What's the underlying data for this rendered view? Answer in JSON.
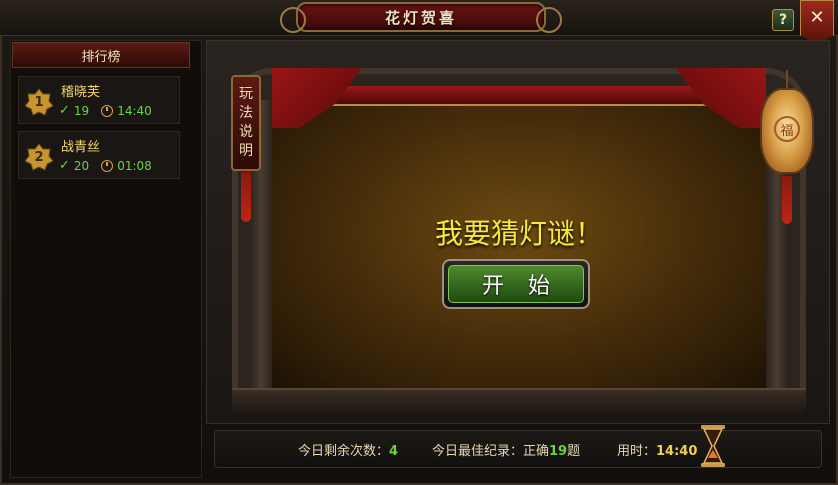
{
  "window": {
    "title": "花灯贺喜",
    "help_label": "?",
    "close_label": "✕"
  },
  "leaderboard": {
    "header": "排行榜",
    "entries": [
      {
        "rank": "1",
        "name": "稽晓芙",
        "correct": "19",
        "time": "14:40"
      },
      {
        "rank": "2",
        "name": "战青丝",
        "correct": "20",
        "time": "01:08"
      }
    ]
  },
  "stage": {
    "rules_chars": [
      "玩",
      "法",
      "说",
      "明"
    ],
    "lantern_mark": "福",
    "prompt": "我要猜灯谜！",
    "start_label": "开始"
  },
  "status": {
    "remaining_label": "今日剩余次数：",
    "remaining_value": "4",
    "best_label": "今日最佳纪录：正确",
    "best_value": "19",
    "best_suffix": "题",
    "time_label": "用时：",
    "time_value": "14:40"
  },
  "colors": {
    "accent_green": "#67d43c",
    "prompt_yellow": "#f3ea3c",
    "name_gold": "#f4d66a"
  }
}
